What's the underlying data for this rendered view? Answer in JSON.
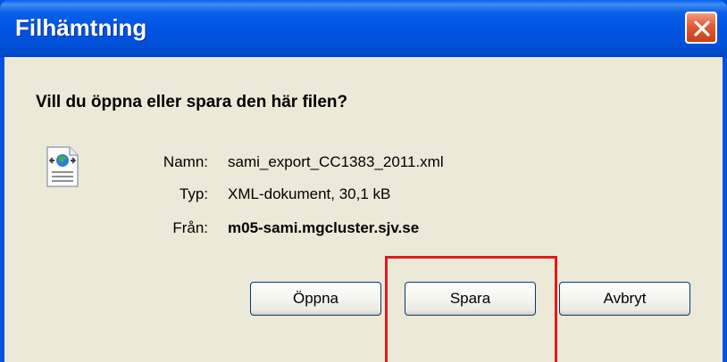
{
  "window": {
    "title": "Filhämtning"
  },
  "dialog": {
    "question": "Vill du öppna eller spara den här filen?",
    "name_label": "Namn:",
    "name_value": "sami_export_CC1383_2011.xml",
    "type_label": "Typ:",
    "type_value": "XML-dokument, 30,1 kB",
    "from_label": "Från:",
    "from_value": "m05-sami.mgcluster.sjv.se"
  },
  "buttons": {
    "open": "Öppna",
    "save": "Spara",
    "cancel": "Avbryt"
  },
  "icons": {
    "close": "close-icon",
    "file": "xml-file-icon"
  },
  "colors": {
    "titlebar": "#0054e3",
    "client": "#ece9d8",
    "close": "#e05a33",
    "highlight": "#e21a1a"
  }
}
